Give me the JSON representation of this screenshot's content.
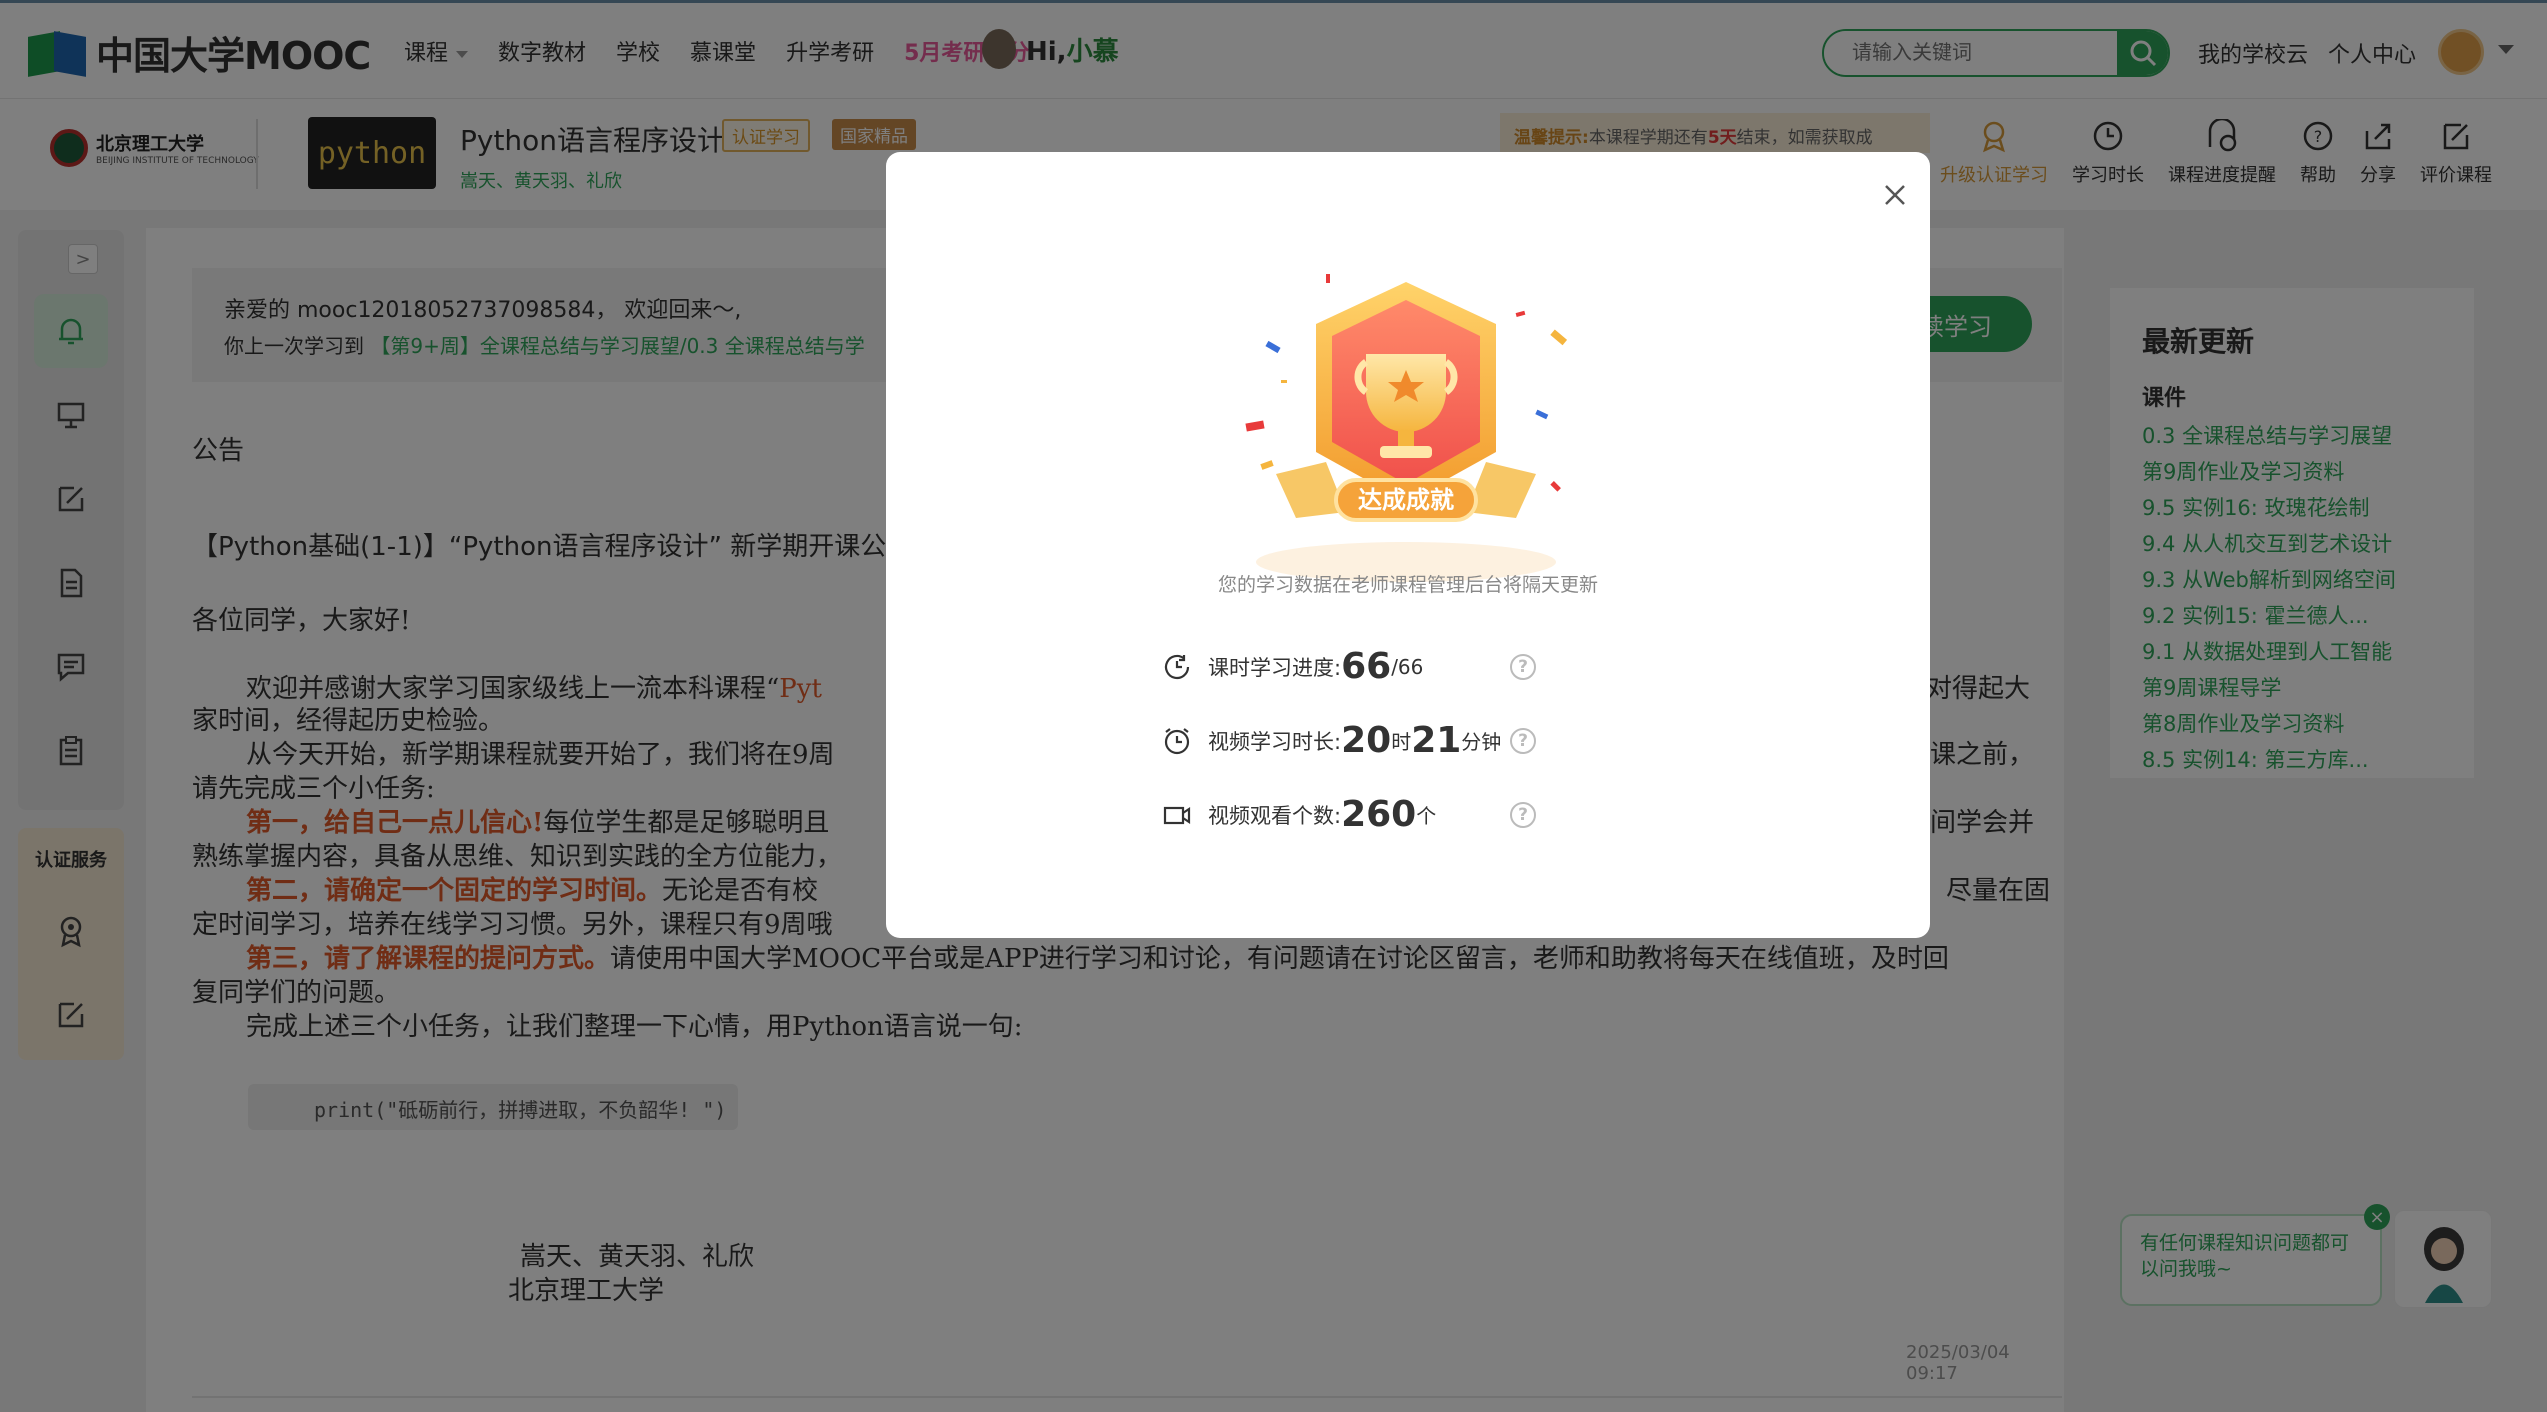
{
  "nav": {
    "logo": "中国大学MOOC",
    "links": [
      "课程",
      "数字教材",
      "学校",
      "慕课堂",
      "升学考研"
    ],
    "promo": "5月考研提分",
    "greeting_hi": "Hi,",
    "greeting_name": "小慕",
    "search_placeholder": "请输入关键词",
    "right_links": [
      "我的学校云",
      "个人中心"
    ]
  },
  "course": {
    "school_name": "北京理工大学",
    "school_sub": "BEIJING INSTITUTE OF TECHNOLOGY",
    "cover_text": "python",
    "title": "Python语言程序设计",
    "tag_cert": "认证学习",
    "tag_national": "国家精品",
    "teachers": "嵩天、黄天羽、礼欣",
    "tip_label": "温馨提示:",
    "tip_text": "本课程学期还有",
    "tip_days": "5天",
    "tip_text2": "结束，如需获取成",
    "tools": [
      "升级认证学习",
      "学习时长",
      "课程进度提醒",
      "帮助",
      "分享",
      "评价课程"
    ]
  },
  "sidebar": {
    "cert_label": "认证服务",
    "expand_label": ">"
  },
  "main": {
    "welcome_line1": "亲爱的 mooc12018052737098584， 欢迎回来～,",
    "welcome_line2_prefix": "你上一次学习到",
    "welcome_line2_link": "【第9+周】全课程总结与学习展望/0.3 全课程总结与学",
    "continue_label": "续学习",
    "announcement_heading": "公告",
    "announcement_title": "【Python基础(1-1)】“Python语言程序设计” 新学期开课公",
    "greeting": "各位同学，大家好!",
    "p1a": "欢迎并感谢大家学习国家级线上一流本科课程“",
    "p1b": "Pyt",
    "p1c": "对得起大",
    "p1d": "家时间，经得起历史检验。",
    "p2a": "从今天开始，新学期课程就要开始了，我们将在9周",
    "p2b": "课之前，",
    "p2c": "请先完成三个小任务:",
    "t1": "第一，给自己一点儿信心!",
    "t1b": "每位学生都是足够聪明且",
    "t1c": "间学会并",
    "t1d": "熟练掌握内容，具备从思维、知识到实践的全方位能力，",
    "t2": "第二，请确定一个固定的学习时间。",
    "t2b": "无论是否有校",
    "t2c": "尽量在固",
    "t2d": "定时间学习，培养在线学习习惯。另外，课程只有9周哦",
    "t3": "第三，请了解课程的提问方式。",
    "t3b": "请使用中国大学MOOC平台或是APP进行学习和讨论，有问题请在讨论区留言，老师和助教将每天在线值班，及时回",
    "t3c": "复同学们的问题。",
    "p4": "完成上述三个小任务，让我们整理一下心情，用Python语言说一句:",
    "code": "print(\"砥砺前行，拼搏进取，不负韶华! \")",
    "sign1": "嵩天、黄天羽、礼欣",
    "sign2": "北京理工大学",
    "date": "2025/03/04 09:17"
  },
  "right_panel": {
    "title": "最新更新",
    "section": "课件",
    "items": [
      "0.3 全课程总结与学习展望",
      "第9周作业及学习资料",
      "9.5 实例16: 玫瑰花绘制",
      "9.4 从人机交互到艺术设计",
      "9.3 从Web解析到网络空间",
      "9.2 实例15: 霍兰德人...",
      "9.1 从数据处理到人工智能",
      "第9周课程导学",
      "第8周作业及学习资料",
      "8.5 实例14: 第三方库..."
    ]
  },
  "chat": {
    "bubble": "有任何课程知识问题都可以问我哦~"
  },
  "modal": {
    "badge_text": "达成成就",
    "tip": "您的学习数据在老师课程管理后台将隔天更新",
    "stats": [
      {
        "label": "课时学习进度:",
        "value": "66",
        "suffix": "/66"
      },
      {
        "label": "视频学习时长:",
        "value_h": "20",
        "unit_h": "时",
        "value_m": "21",
        "unit_m": "分钟"
      },
      {
        "label": "视频观看个数:",
        "value": "260",
        "suffix": "个"
      }
    ],
    "help": "?"
  },
  "colors": {
    "brand_green": "#2fa55a",
    "accent_orange": "#e05a2b",
    "gold": "#d79a3a"
  }
}
